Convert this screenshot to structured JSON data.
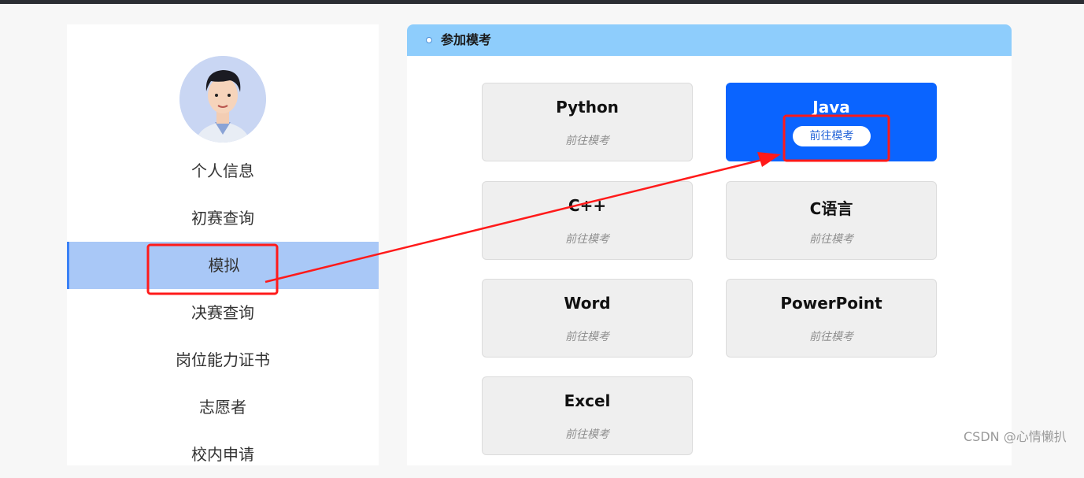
{
  "sidebar": {
    "items": [
      {
        "label": "个人信息"
      },
      {
        "label": "初赛查询"
      },
      {
        "label": "模拟"
      },
      {
        "label": "决赛查询"
      },
      {
        "label": "岗位能力证书"
      },
      {
        "label": "志愿者"
      },
      {
        "label": "校内申请"
      }
    ],
    "active_index": 2
  },
  "main": {
    "header_title": "参加模考",
    "cards": [
      {
        "title": "Python",
        "action": "前往模考"
      },
      {
        "title": "Java",
        "action": "前往模考"
      },
      {
        "title": "C++",
        "action": "前往模考"
      },
      {
        "title": "C语言",
        "action": "前往模考"
      },
      {
        "title": "Word",
        "action": "前往模考"
      },
      {
        "title": "PowerPoint",
        "action": "前往模考"
      },
      {
        "title": "Excel",
        "action": "前往模考"
      }
    ]
  },
  "colors": {
    "accent_blue": "#0a64ff",
    "header_blue": "#8ecdfc",
    "active_menu": "#a9c8f7",
    "annotation_red": "#ff1a1a"
  },
  "watermark": "CSDN @心情懒扒"
}
